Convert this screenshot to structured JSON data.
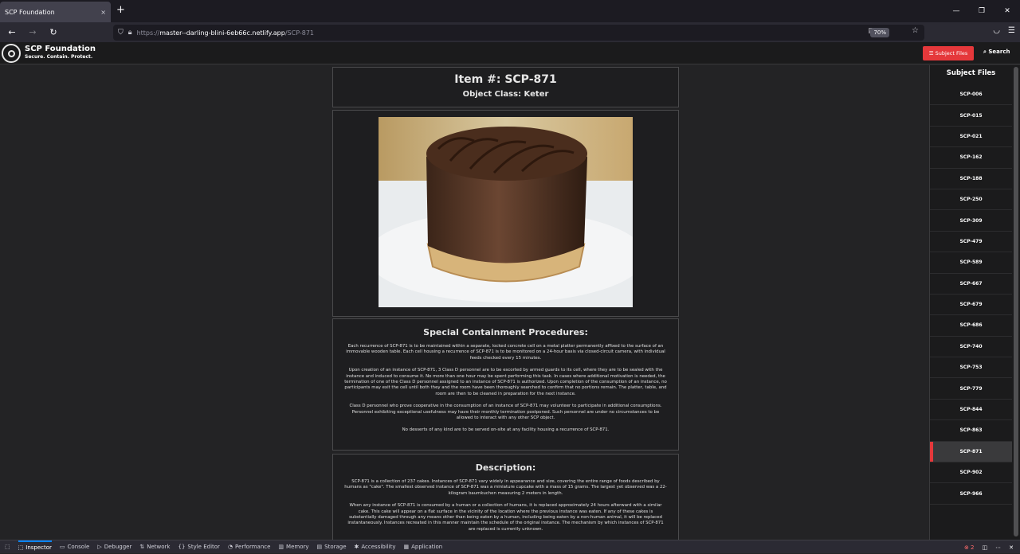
{
  "browser": {
    "tab_title": "SCP Foundation",
    "tab_close": "×",
    "new_tab": "+",
    "url_protocol": "https://",
    "url_host": "master--darling-blini-6eb66c.netlify.app",
    "url_path": "/SCP-871",
    "zoom": "70%",
    "win_minimize": "—",
    "win_restore": "❐",
    "win_close": "✕"
  },
  "site": {
    "brand": "SCP Foundation",
    "tagline": "Secure. Contain. Protect.",
    "subject_files_button": "☰ Subject Files",
    "search_button": "⌕ Search"
  },
  "item": {
    "title": "Item #: SCP-871",
    "object_class": "Object Class: Keter"
  },
  "containment": {
    "title": "Special Containment Procedures:",
    "paragraphs": [
      "Each recurrence of SCP-871 is to be maintained within a separate, locked concrete cell on a metal platter permanently affixed to the surface of an immovable wooden table. Each cell housing a recurrence of SCP-871 is to be monitored on a 24-hour basis via closed-circuit camera, with individual feeds checked every 15 minutes.",
      "Upon creation of an instance of SCP-871, 3 Class D personnel are to be escorted by armed guards to its cell, where they are to be sealed with the instance and induced to consume it. No more than one hour may be spent performing this task. In cases where additional motivation is needed, the termination of one of the Class D personnel assigned to an instance of SCP-871 is authorized. Upon completion of the consumption of an instance, no participants may exit the cell until both they and the room have been thoroughly searched to confirm that no portions remain. The platter, table, and room are then to be cleaned in preparation for the next instance.",
      "Class D personnel who prove cooperative in the consumption of an instance of SCP-871 may volunteer to participate in additional consumptions. Personnel exhibiting exceptional usefulness may have their monthly termination postponed. Such personnel are under no circumstances to be allowed to interact with any other SCP object.",
      "No desserts of any kind are to be served on-site at any facility housing a recurrence of SCP-871."
    ]
  },
  "description": {
    "title": "Description:",
    "paragraphs": [
      "SCP-871 is a collection of 237 cakes. Instances of SCP-871 vary widely in appearance and size, covering the entire range of foods described by humans as \"cake\". The smallest observed instance of SCP-871 was a miniature cupcake with a mass of 15 grams. The largest yet observed was a 22-kilogram baumkuchen measuring 2 meters in length.",
      "When any instance of SCP-871 is consumed by a human or a collection of humans, it is replaced approximately 24 hours afterward with a similar cake. This cake will appear on a flat surface in the vicinity of the location where the previous instance was eaten. If any of these cakes is substantially damaged through any means other than being eaten by a human, including being eaten by a non-human animal, it will be replaced instantaneously. Instances recreated in this manner maintain the schedule of the original instance. The mechanism by which instances of SCP-871 are replaced is currently unknown."
    ]
  },
  "sidebar": {
    "title": "Subject Files",
    "items": [
      "SCP-006",
      "SCP-015",
      "SCP-021",
      "SCP-162",
      "SCP-188",
      "SCP-250",
      "SCP-309",
      "SCP-479",
      "SCP-589",
      "SCP-667",
      "SCP-679",
      "SCP-686",
      "SCP-740",
      "SCP-753",
      "SCP-779",
      "SCP-844",
      "SCP-863",
      "SCP-871",
      "SCP-902",
      "SCP-966"
    ],
    "active": "SCP-871"
  },
  "devtools": {
    "tabs": [
      "Inspector",
      "Console",
      "Debugger",
      "Network",
      "Style Editor",
      "Performance",
      "Memory",
      "Storage",
      "Accessibility",
      "Application"
    ],
    "selected": "Inspector",
    "error_count": "2"
  },
  "colors": {
    "accent": "#e5383b",
    "background": "#232325",
    "panel": "#1b1b1c"
  }
}
